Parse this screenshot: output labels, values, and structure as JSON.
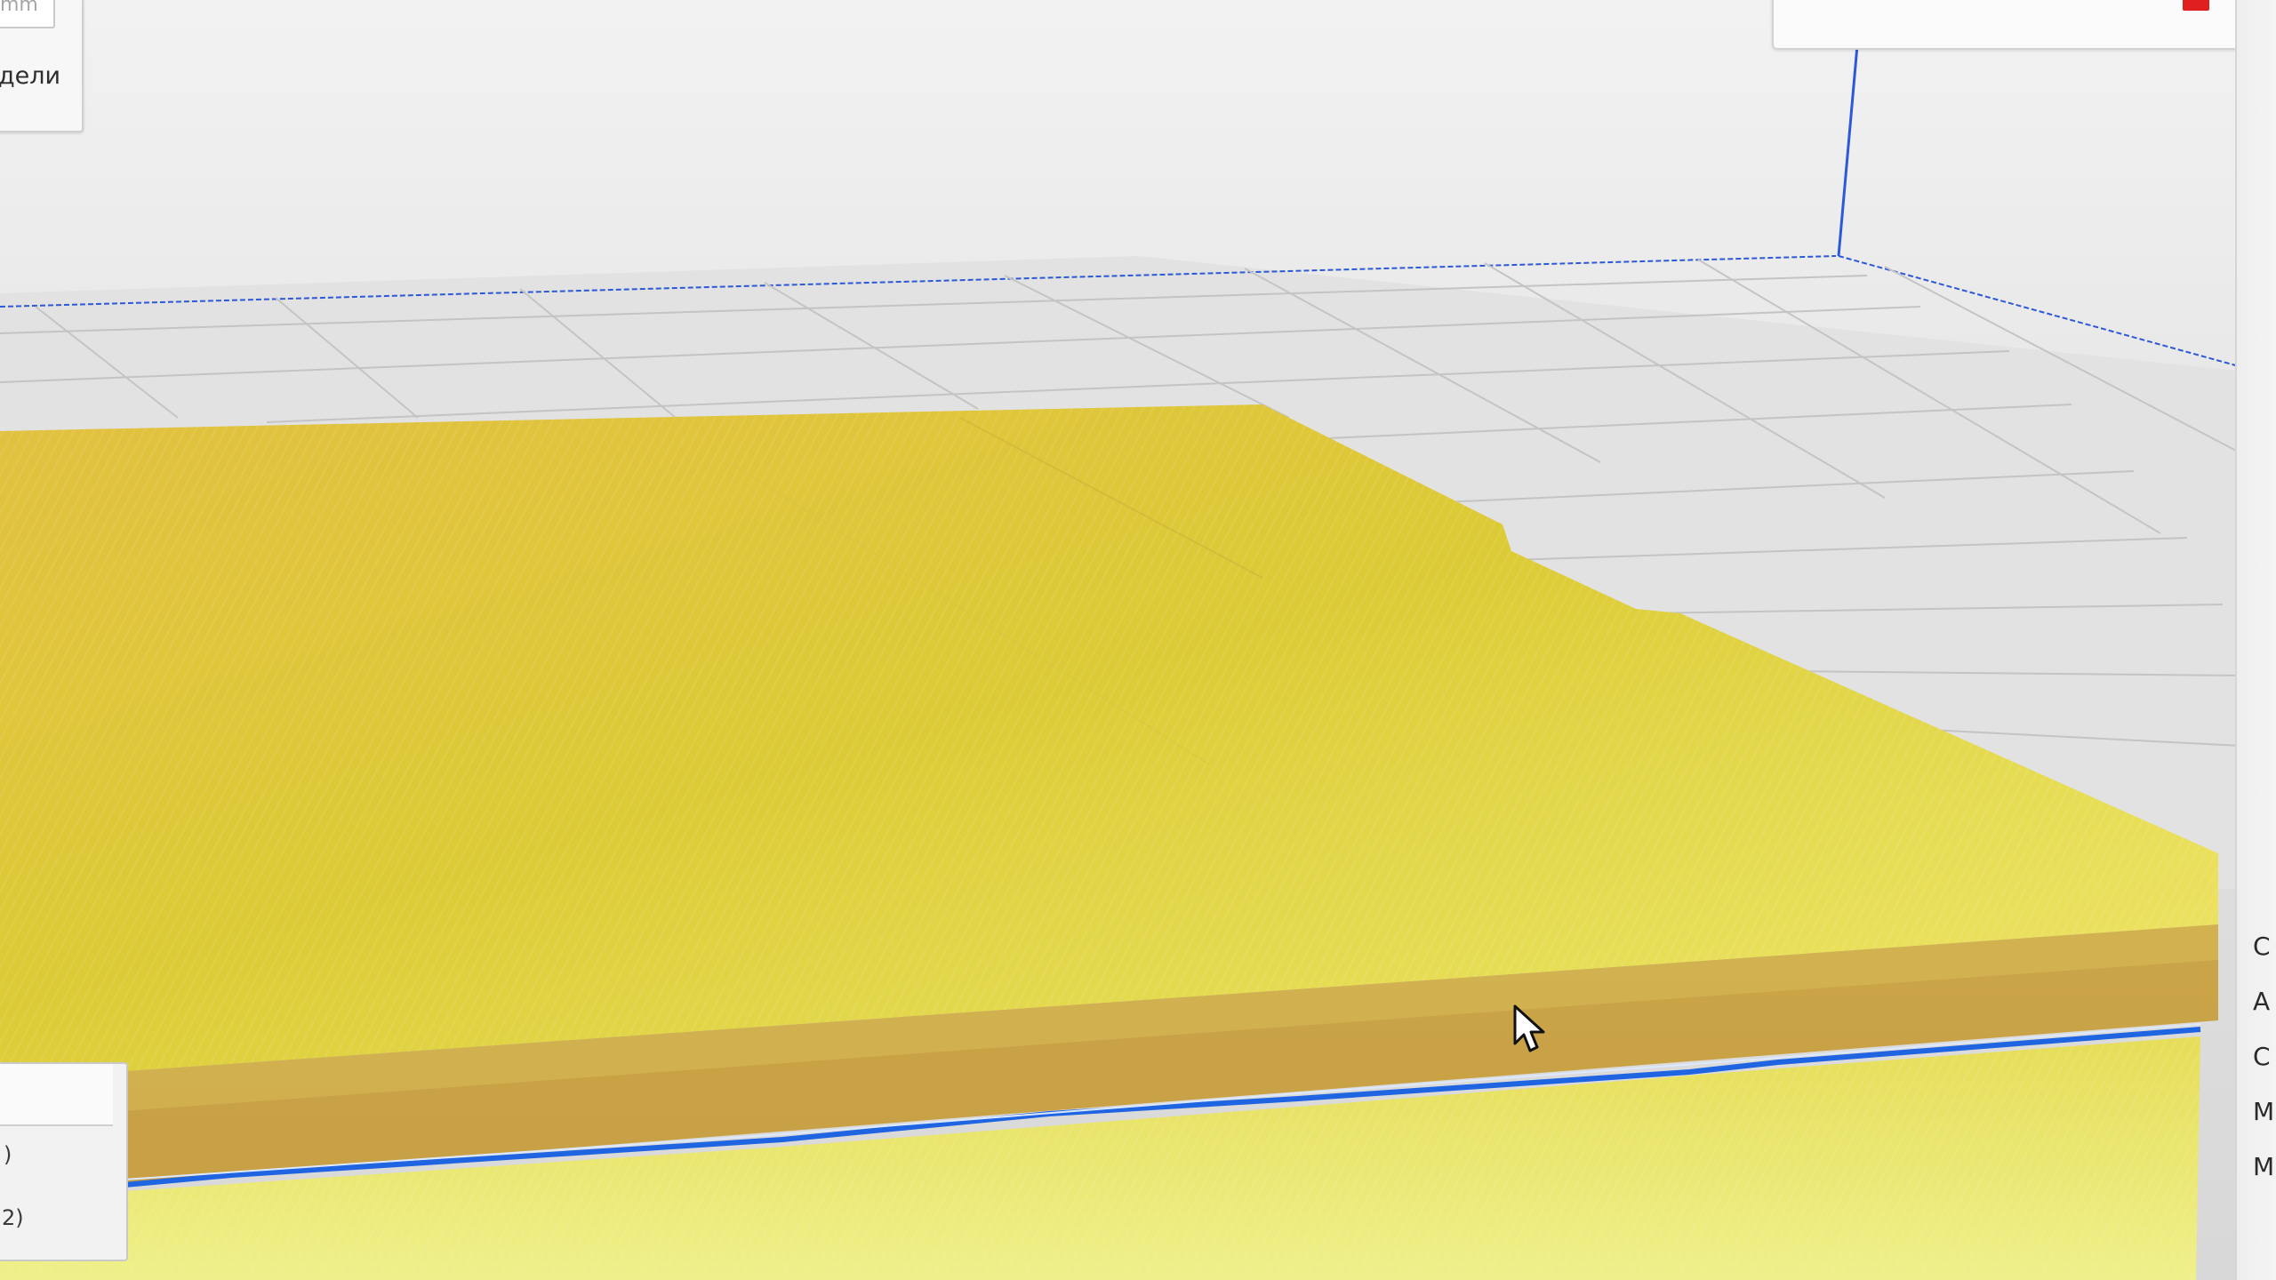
{
  "window": {
    "title": ""
  },
  "left_panel_top": {
    "unit_label": "mm",
    "label": "дели"
  },
  "left_panel_bottom": {
    "items": [
      {
        "label": ")"
      },
      {
        "label": "2)"
      }
    ]
  },
  "right_side_column": {
    "letters": [
      "C",
      "A",
      "C",
      "M",
      "M"
    ]
  },
  "viewport": {
    "scene": "3d-build-plate-preview",
    "object_color": "#e2c534",
    "edge_highlight_color": "#1f64e0",
    "grid_color": "#c9c9c9"
  },
  "icons": {
    "close_indicator": "red-square-icon",
    "pointer": "mouse-pointer-icon"
  }
}
